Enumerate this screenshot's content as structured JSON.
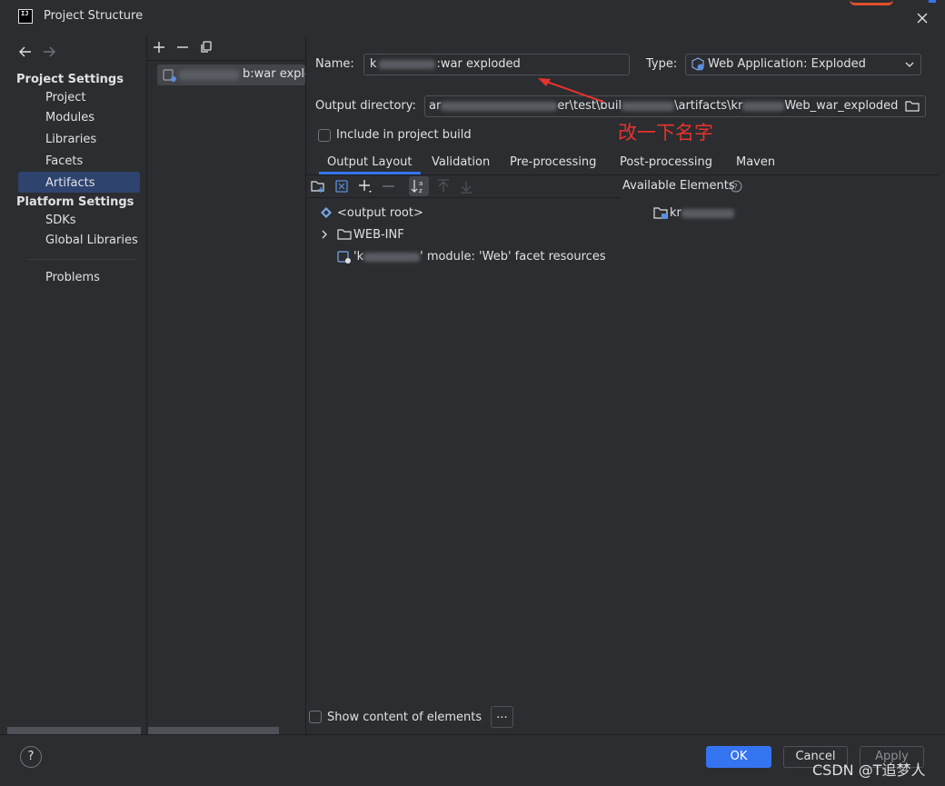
{
  "window": {
    "title": "Project Structure",
    "logo_text": "IJ"
  },
  "nav": {
    "project_settings_heading": "Project Settings",
    "project_settings_items": [
      "Project",
      "Modules",
      "Libraries",
      "Facets",
      "Artifacts"
    ],
    "platform_settings_heading": "Platform Settings",
    "platform_settings_items": [
      "SDKs",
      "Global Libraries"
    ],
    "problems": "Problems",
    "selected": "Artifacts"
  },
  "artifact_list": {
    "selected_item": "b:war exploc"
  },
  "form": {
    "name_label": "Name:",
    "name_value_prefix": "k",
    "name_value_suffix": ":war exploded",
    "type_label": "Type:",
    "type_value": "Web Application: Exploded",
    "output_dir_label": "Output directory:",
    "output_dir_fragments": [
      "ar",
      "er\\test\\buil",
      "\\artifacts\\kr",
      "Web_war_exploded"
    ],
    "include_in_build": "Include in project build",
    "include_in_build_checked": false
  },
  "annotation": {
    "text": "改一下名字",
    "color": "#e8322e"
  },
  "tabs": [
    "Output Layout",
    "Validation",
    "Pre-processing",
    "Post-processing",
    "Maven"
  ],
  "active_tab": "Output Layout",
  "layout_tree": {
    "output_root": "<output root>",
    "web_inf": "WEB-INF",
    "facet_prefix": "'k",
    "facet_suffix": "' module: 'Web' facet resources"
  },
  "available_elements": {
    "label": "Available Elements",
    "item": "kr"
  },
  "footer": {
    "show_content": "Show content of elements",
    "show_content_checked": false,
    "ellipsis": "...",
    "ok": "OK",
    "cancel": "Cancel",
    "apply": "Apply",
    "help": "?"
  },
  "watermark": "CSDN @T追梦人",
  "colors": {
    "accent": "#3574f0",
    "background": "#2b2d30",
    "selection": "#2e436e",
    "annotation": "#e8322e"
  }
}
